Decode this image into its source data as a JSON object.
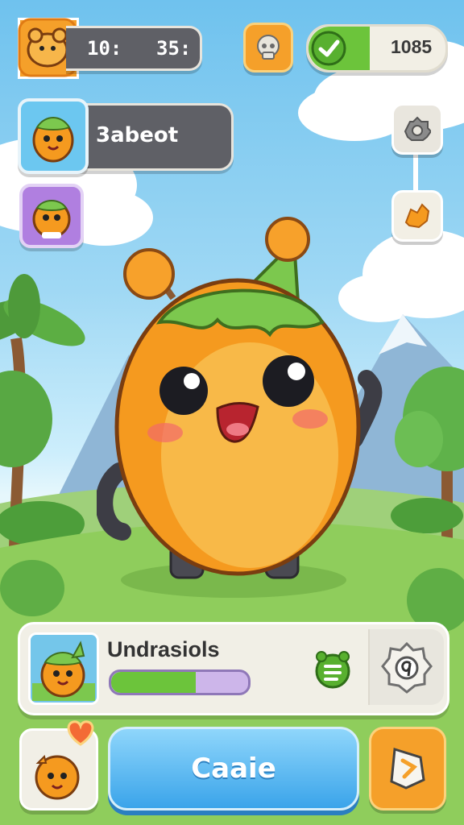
{
  "hud": {
    "timer_left": "10:",
    "timer_right": "35:",
    "coins": "1085"
  },
  "pets": {
    "selected_name": "3abeot"
  },
  "status_panel": {
    "name": "Undrasiols",
    "progress": 0.62
  },
  "actions": {
    "main_label": "Caaie"
  },
  "colors": {
    "accent_orange": "#f5a02a",
    "accent_green": "#6cc43b",
    "accent_blue": "#4fb6f0",
    "panel_grey": "#5f6066"
  }
}
